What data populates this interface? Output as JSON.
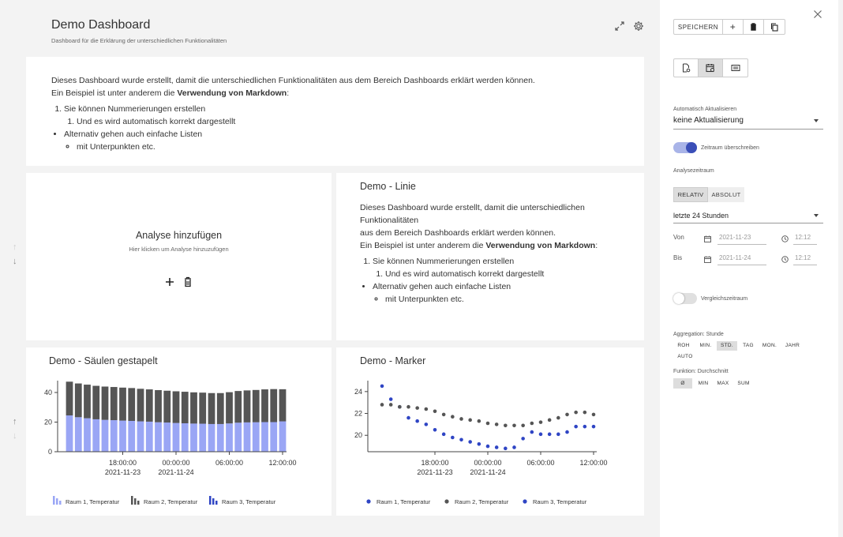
{
  "dashboard": {
    "title": "Demo Dashboard",
    "subtitle": "Dashboard für die Erklärung der unterschiedlichen Funktionalitäten"
  },
  "markdown": {
    "intro": "Dieses Dashboard wurde erstellt, damit die unterschiedlichen Funktionalitäten aus dem Bereich Dashboards erklärt werden können.",
    "example_prefix": "Ein Beispiel ist unter anderem die ",
    "example_bold": "Verwendung von Markdown",
    "example_suffix": ":",
    "list_item1": "Sie können Nummerierungen erstellen",
    "list_item1_sub": "Und es wird automatisch korrekt dargestellt",
    "list_item2": "Alternativ gehen auch einfache Listen",
    "list_item2_sub": "mit Unterpunkten etc.",
    "intro_line1": "Dieses Dashboard wurde erstellt, damit die unterschiedlichen Funktionalitäten",
    "intro_line2": "aus dem Bereich Dashboards erklärt werden können."
  },
  "add_analysis": {
    "title": "Analyse hinzufügen",
    "hint": "Hier klicken um Analyse hinzuzufügen"
  },
  "cards": {
    "linie_title": "Demo - Linie",
    "saeulen_title": "Demo - Säulen gestapelt",
    "marker_title": "Demo - Marker"
  },
  "panel": {
    "save_label": "SPEICHERN",
    "auto_refresh_label": "Automatisch Aktualisieren",
    "auto_refresh_value": "keine Aktualisierung",
    "override_label": "Zeitraum überschreiben",
    "analysis_period_label": "Analysezeitraum",
    "relative_label": "RELATIV",
    "absolute_label": "ABSOLUT",
    "period_value": "letzte 24 Stunden",
    "from_label": "Von",
    "to_label": "Bis",
    "from_date": "2021-11-23",
    "from_time": "12:12",
    "to_date": "2021-11-24",
    "to_time": "12:12",
    "compare_label": "Vergleichszeitraum",
    "aggregation_label": "Aggregation: Stunde",
    "aggregation_options": [
      "ROH",
      "MIN.",
      "STD.",
      "TAG",
      "MON.",
      "JAHR",
      "AUTO"
    ],
    "function_label": "Funktion: Durchschnitt",
    "function_options": [
      "Ø",
      "MIN",
      "MAX",
      "SUM"
    ]
  },
  "colors": {
    "series1_bar": "#9aa6f5",
    "series2": "#555555",
    "series3": "#2f45c4",
    "toggle_on": "#3b4fb8"
  },
  "chart_data": [
    {
      "type": "bar",
      "title": "Demo - Säulen gestapelt",
      "stacked": true,
      "x": [
        "12:00",
        "13:00",
        "14:00",
        "15:00",
        "16:00",
        "17:00",
        "18:00",
        "19:00",
        "20:00",
        "21:00",
        "22:00",
        "23:00",
        "00:00",
        "01:00",
        "02:00",
        "03:00",
        "04:00",
        "05:00",
        "06:00",
        "07:00",
        "08:00",
        "09:00",
        "10:00",
        "11:00",
        "12:00"
      ],
      "x_tick_labels": [
        "18:00:00",
        "00:00:00",
        "06:00:00",
        "12:00:00"
      ],
      "x_tick_sublabels": [
        "2021-11-23",
        "2021-11-24",
        "",
        ""
      ],
      "y_ticks": [
        "0",
        "20",
        "40"
      ],
      "ylim": [
        0,
        48
      ],
      "series": [
        {
          "name": "Raum 1, Temperatur",
          "values": [
            24.5,
            23.3,
            22.6,
            21.9,
            21.5,
            21.3,
            21.0,
            20.8,
            20.5,
            20.3,
            19.9,
            19.7,
            19.4,
            19.2,
            19.0,
            18.9,
            18.7,
            18.7,
            19.1,
            19.6,
            19.8,
            19.9,
            20.0,
            20.0,
            20.5
          ]
        },
        {
          "name": "Raum 2, Temperatur",
          "values": [
            22.8,
            22.8,
            22.7,
            22.6,
            22.5,
            22.4,
            22.3,
            22.2,
            22.0,
            21.8,
            21.7,
            21.5,
            21.4,
            21.3,
            21.1,
            21.0,
            20.9,
            20.9,
            21.1,
            21.4,
            21.6,
            21.8,
            22.1,
            22.3,
            21.7
          ]
        },
        {
          "name": "Raum 3, Temperatur",
          "values": [
            0,
            0,
            0,
            0,
            0,
            0,
            0,
            0,
            0,
            0,
            0,
            0,
            0,
            0,
            0,
            0,
            0,
            0,
            0,
            0,
            0,
            0,
            0,
            0,
            0
          ]
        }
      ],
      "legend_position": "bottom"
    },
    {
      "type": "scatter",
      "title": "Demo - Marker",
      "x": [
        "12:00",
        "13:00",
        "14:00",
        "15:00",
        "16:00",
        "17:00",
        "18:00",
        "19:00",
        "20:00",
        "21:00",
        "22:00",
        "23:00",
        "00:00",
        "01:00",
        "02:00",
        "03:00",
        "04:00",
        "05:00",
        "06:00",
        "07:00",
        "08:00",
        "09:00",
        "10:00",
        "11:00",
        "12:00"
      ],
      "x_tick_labels": [
        "18:00:00",
        "00:00:00",
        "06:00:00",
        "12:00:00"
      ],
      "x_tick_sublabels": [
        "2021-11-23",
        "2021-11-24",
        "",
        ""
      ],
      "y_ticks": [
        "20",
        "22",
        "24"
      ],
      "ylim": [
        18.5,
        25
      ],
      "series": [
        {
          "name": "Raum 1, Temperatur",
          "values": [
            24.5,
            23.3,
            22.6,
            21.6,
            21.3,
            21.0,
            20.5,
            20.1,
            19.8,
            19.6,
            19.4,
            19.2,
            19.0,
            18.9,
            18.8,
            18.9,
            19.7,
            20.3,
            20.1,
            20.1,
            20.1,
            20.3,
            20.8,
            20.8,
            20.8
          ]
        },
        {
          "name": "Raum 2, Temperatur",
          "values": [
            22.8,
            22.8,
            22.6,
            22.6,
            22.5,
            22.4,
            22.2,
            21.9,
            21.7,
            21.5,
            21.4,
            21.3,
            21.1,
            21.0,
            20.9,
            20.9,
            20.9,
            21.1,
            21.2,
            21.4,
            21.6,
            21.9,
            22.1,
            22.1,
            21.9
          ]
        },
        {
          "name": "Raum 3, Temperatur",
          "values": []
        }
      ],
      "legend_position": "bottom"
    }
  ]
}
